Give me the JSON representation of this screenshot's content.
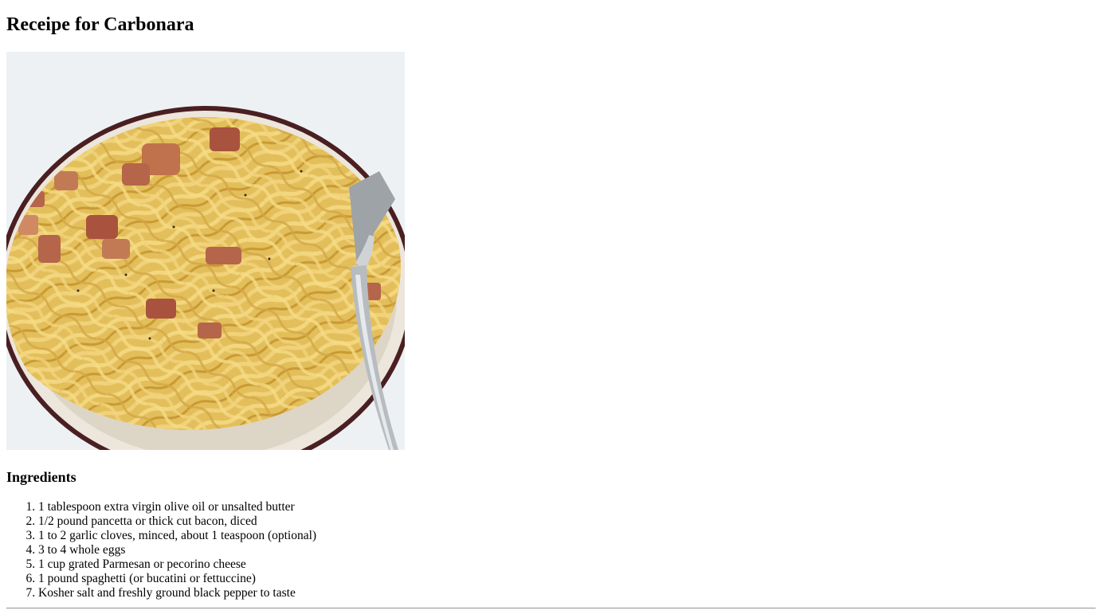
{
  "page": {
    "title": "Receipe for Carbonara",
    "image_alt": "Bowl of spaghetti carbonara with a fork"
  },
  "ingredients": {
    "heading": "Ingredients",
    "items": [
      "1 tablespoon extra virgin olive oil or unsalted butter",
      "1/2 pound pancetta or thick cut bacon, diced",
      "1 to 2 garlic cloves, minced, about 1 teaspoon (optional)",
      "3 to 4 whole eggs",
      "1 cup grated Parmesan or pecorino cheese",
      "1 pound spaghetti (or bucatini or fettuccine)",
      "Kosher salt and freshly ground black pepper to taste"
    ]
  },
  "colors": {
    "bowl_rim": "#4a1f22",
    "bowl_inner": "#ece6dc",
    "pasta": "#e8c766",
    "pasta_shade": "#c99a33",
    "pancetta": "#b5654a",
    "background": "#e9ecef"
  }
}
